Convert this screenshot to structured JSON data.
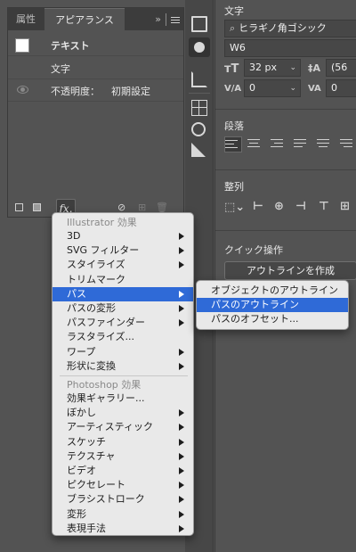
{
  "appearance_panel": {
    "tab_properties": "属性",
    "tab_appearance": "アピアランス",
    "collapse_glyph": "»",
    "rows": {
      "object_type": "テキスト",
      "characters": "文字",
      "opacity_label": "不透明度：",
      "opacity_value": "初期設定"
    },
    "footer": {
      "fx_label": "fx."
    }
  },
  "character_panel": {
    "section_title": "文字",
    "font_family": "ヒラギノ角ゴシック",
    "font_style": "W6",
    "font_size": "32 px",
    "leading_partial": "(56",
    "kerning": "0",
    "tracking": "0",
    "paragraph_title": "段落",
    "align_title": "整列",
    "quick_actions_title": "クイック操作",
    "outline_button": "アウトラインを作成"
  },
  "effect_menu": {
    "illustrator_header": "Illustrator 効果",
    "illustrator_items": [
      {
        "label": "3D",
        "submenu": true
      },
      {
        "label": "SVG フィルター",
        "submenu": true
      },
      {
        "label": "スタイライズ",
        "submenu": true
      },
      {
        "label": "トリムマーク",
        "submenu": false
      },
      {
        "label": "パス",
        "submenu": true,
        "selected": true
      },
      {
        "label": "パスの変形",
        "submenu": true
      },
      {
        "label": "パスファインダー",
        "submenu": true
      },
      {
        "label": "ラスタライズ...",
        "submenu": false
      },
      {
        "label": "ワープ",
        "submenu": true
      },
      {
        "label": "形状に変換",
        "submenu": true
      }
    ],
    "photoshop_header": "Photoshop 効果",
    "photoshop_items": [
      {
        "label": "効果ギャラリー...",
        "submenu": false
      },
      {
        "label": "ぼかし",
        "submenu": true
      },
      {
        "label": "アーティスティック",
        "submenu": true
      },
      {
        "label": "スケッチ",
        "submenu": true
      },
      {
        "label": "テクスチャ",
        "submenu": true
      },
      {
        "label": "ビデオ",
        "submenu": true
      },
      {
        "label": "ピクセレート",
        "submenu": true
      },
      {
        "label": "ブラシストローク",
        "submenu": true
      },
      {
        "label": "変形",
        "submenu": true
      },
      {
        "label": "表現手法",
        "submenu": true
      }
    ]
  },
  "path_submenu": {
    "items": [
      {
        "label": "オブジェクトのアウトライン",
        "selected": false
      },
      {
        "label": "パスのアウトライン",
        "selected": true
      },
      {
        "label": "パスのオフセット...",
        "selected": false
      }
    ]
  },
  "colors": {
    "panel_bg": "#535353",
    "menu_bg": "#e9e9e9",
    "highlight": "#2f6ad7"
  }
}
